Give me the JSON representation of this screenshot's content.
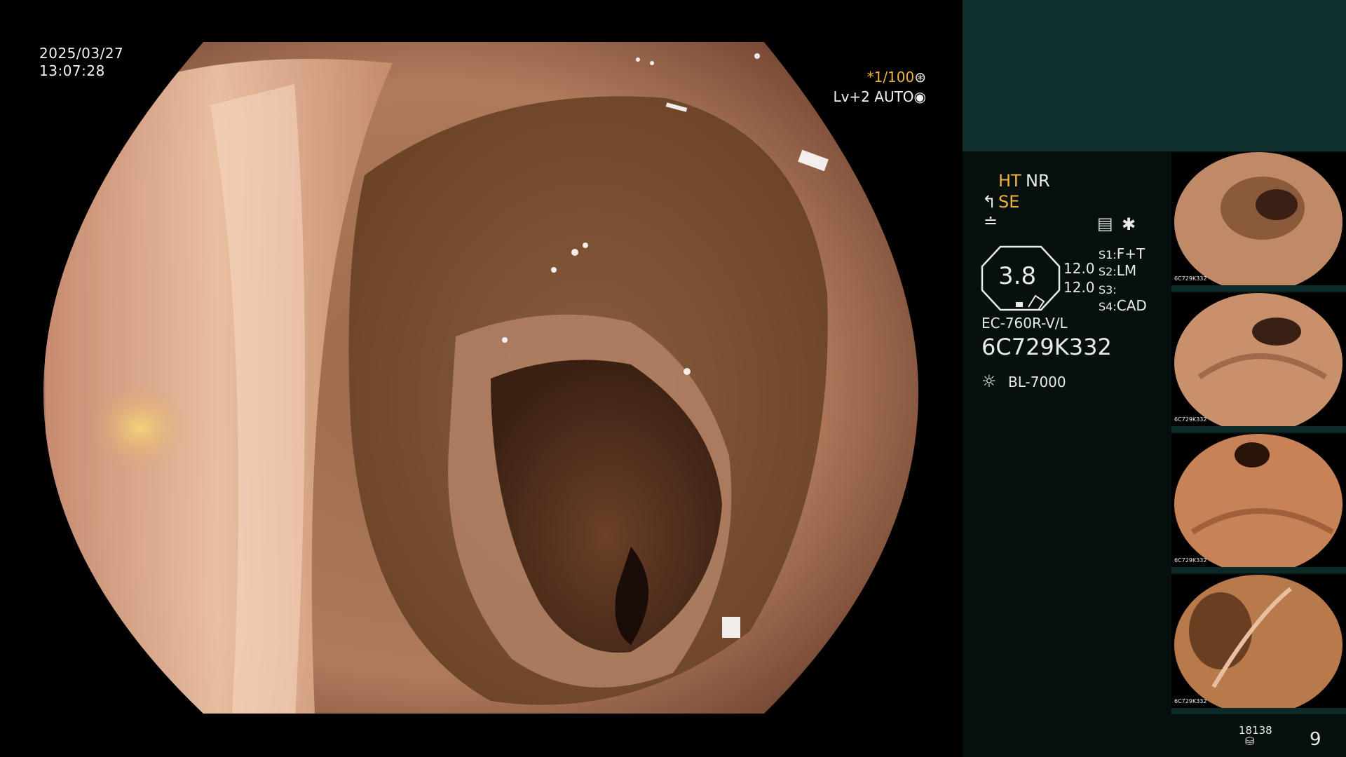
{
  "overlay": {
    "date": "2025/03/27",
    "time": "13:07:28",
    "shutter": "*1/100",
    "level": "Lv+2 AUTO"
  },
  "panel": {
    "ht": "HT",
    "nr": "NR",
    "se": "SE",
    "zoom_value": "3.8",
    "val_1": "12.0",
    "val_2": "12.0",
    "s1_key": "S1:",
    "s1_val": "F+T",
    "s2_key": "S2:",
    "s2_val": "LM",
    "s3_key": "S3:",
    "s3_val": "",
    "s4_key": "S4:",
    "s4_val": "CAD",
    "scope_model": "EC-760R-V/L",
    "serial": "6C729K332",
    "light_source": "BL-7000",
    "storage_count": "18138",
    "capture_count": "9"
  },
  "thumbnails": {
    "label": "6C729K332"
  },
  "colors": {
    "panel_bg": "#06110f",
    "panel_top_bg": "#0f302d",
    "accent_orange": "#f0b23c"
  }
}
